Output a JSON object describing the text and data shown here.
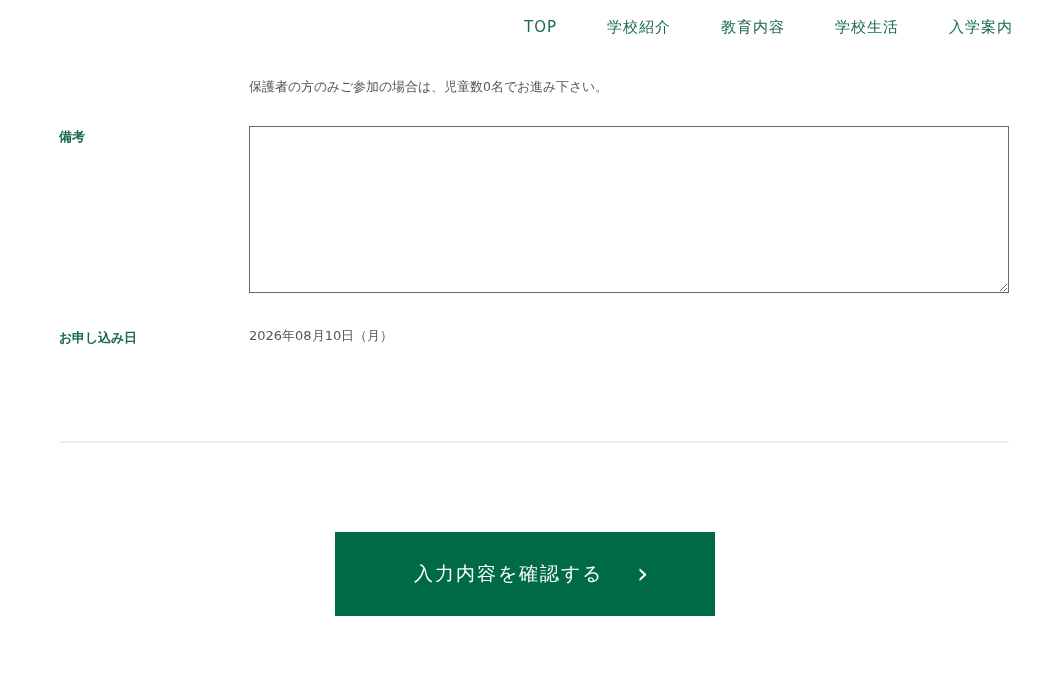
{
  "nav": [
    {
      "label": "TOP"
    },
    {
      "label": "学校紹介"
    },
    {
      "label": "教育内容"
    },
    {
      "label": "学校生活"
    },
    {
      "label": "入学案内"
    }
  ],
  "note": "保護者の方のみご参加の場合は、児童数0名でお進み下さい。",
  "fields": [
    {
      "kind": "textarea",
      "label": "備考"
    },
    {
      "kind": "text",
      "label": "お申し込み日",
      "value": "2026年08月10日（月）"
    }
  ],
  "submit": {
    "label": "入力内容を確認する",
    "icon": "›"
  }
}
